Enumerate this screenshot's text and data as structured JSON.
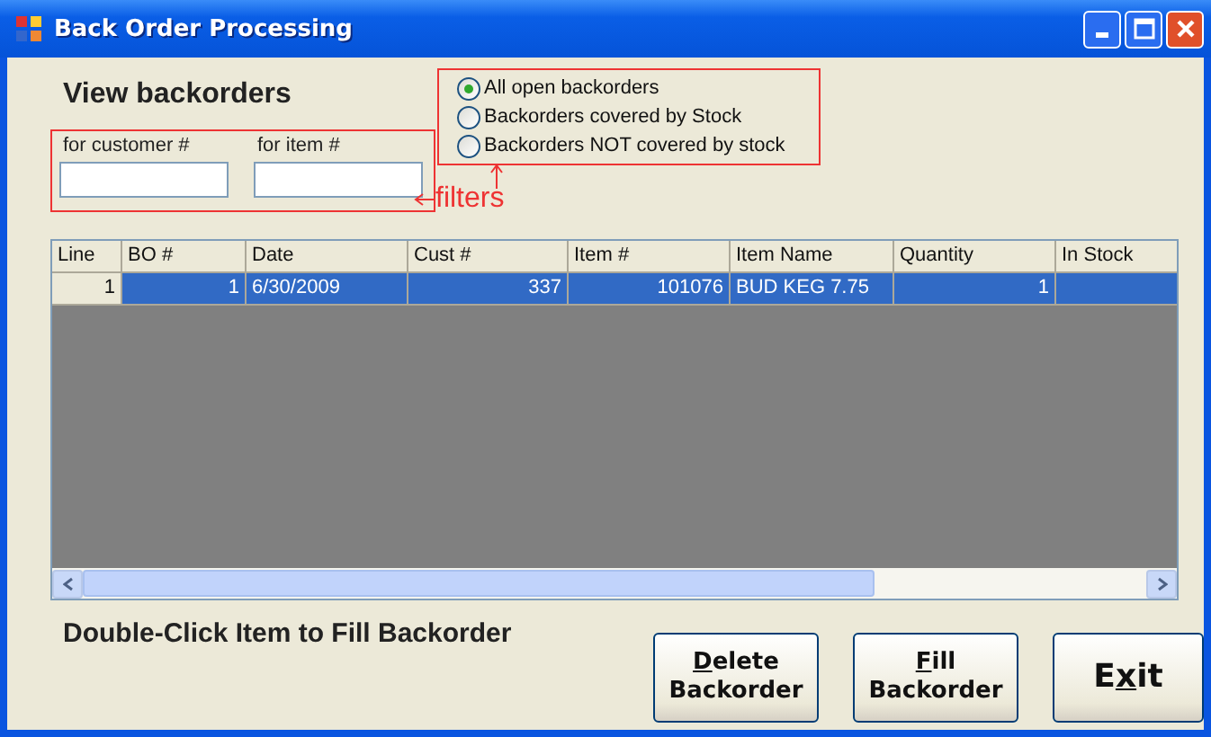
{
  "window": {
    "title": "Back Order Processing"
  },
  "heading": "View backorders",
  "filters": {
    "customer": {
      "label": "for customer #"
    },
    "item": {
      "label": "for item #"
    },
    "annotation": "filters"
  },
  "options": [
    {
      "label": "All open backorders",
      "selected": true
    },
    {
      "label": "Backorders covered by Stock",
      "selected": false
    },
    {
      "label": "Backorders NOT covered by stock",
      "selected": false
    }
  ],
  "table": {
    "columns": [
      "Line",
      "BO #",
      "Date",
      "Cust #",
      "Item #",
      "Item Name",
      "Quantity",
      "In Stock"
    ],
    "rows": [
      {
        "selected": true,
        "cells": [
          "1",
          "1",
          "6/30/2009",
          "337",
          "101076",
          "BUD KEG 7.75",
          "1",
          null
        ]
      }
    ]
  },
  "hint": "Double-Click Item to Fill Backorder",
  "buttons": [
    {
      "kind": "two-line",
      "key": "D",
      "after": "elete",
      "line2": "Backorder"
    },
    {
      "kind": "two-line",
      "key": "F",
      "after": "ill",
      "line2": "Backorder"
    },
    {
      "kind": "single",
      "before": "E",
      "key": "x",
      "after": "it"
    }
  ]
}
